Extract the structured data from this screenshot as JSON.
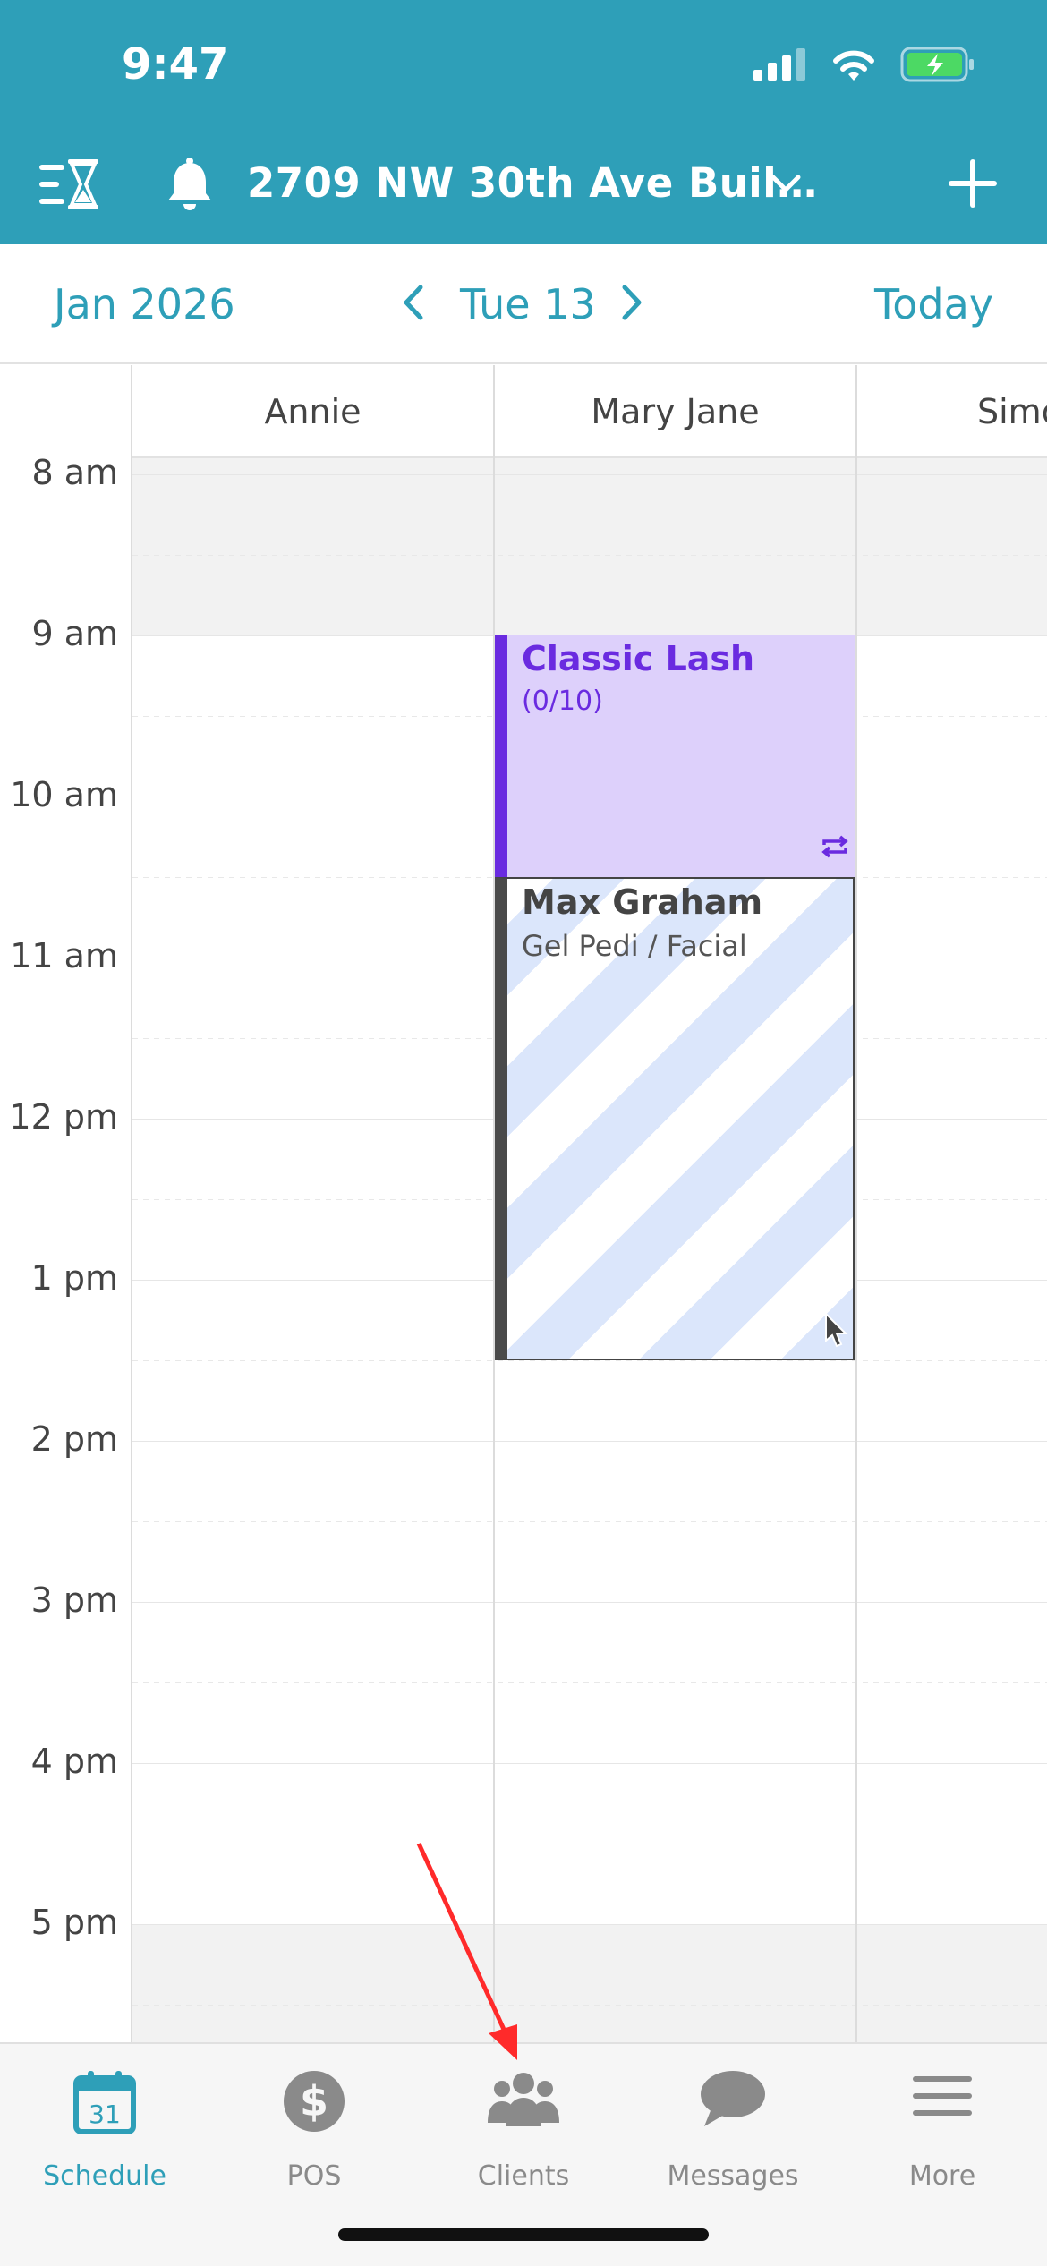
{
  "status": {
    "time": "9:47"
  },
  "header": {
    "location": "2709 NW 30th Ave Buil…"
  },
  "datebar": {
    "month": "Jan 2026",
    "day": "Tue 13",
    "today": "Today"
  },
  "staff": [
    "Annie",
    "Mary Jane",
    "Simo"
  ],
  "times": [
    "8 am",
    "9 am",
    "10 am",
    "11 am",
    "12 pm",
    "1 pm",
    "2 pm",
    "3 pm",
    "4 pm",
    "5 pm"
  ],
  "appointments": [
    {
      "title": "Classic Lash",
      "subtitle": "(0/10)",
      "color": "#6a2be0"
    },
    {
      "title": "Max Graham",
      "subtitle": "Gel Pedi / Facial",
      "color": "#4a4a4a"
    }
  ],
  "tabs": [
    {
      "label": "Schedule",
      "icon": "calendar-icon",
      "calendar_day": "31"
    },
    {
      "label": "POS",
      "icon": "dollar-icon"
    },
    {
      "label": "Clients",
      "icon": "clients-icon"
    },
    {
      "label": "Messages",
      "icon": "messages-icon"
    },
    {
      "label": "More",
      "icon": "menu-icon"
    }
  ],
  "colors": {
    "brand": "#2e9fb8",
    "lash": "#6a2be0",
    "annotation": "#ff2a2a"
  }
}
